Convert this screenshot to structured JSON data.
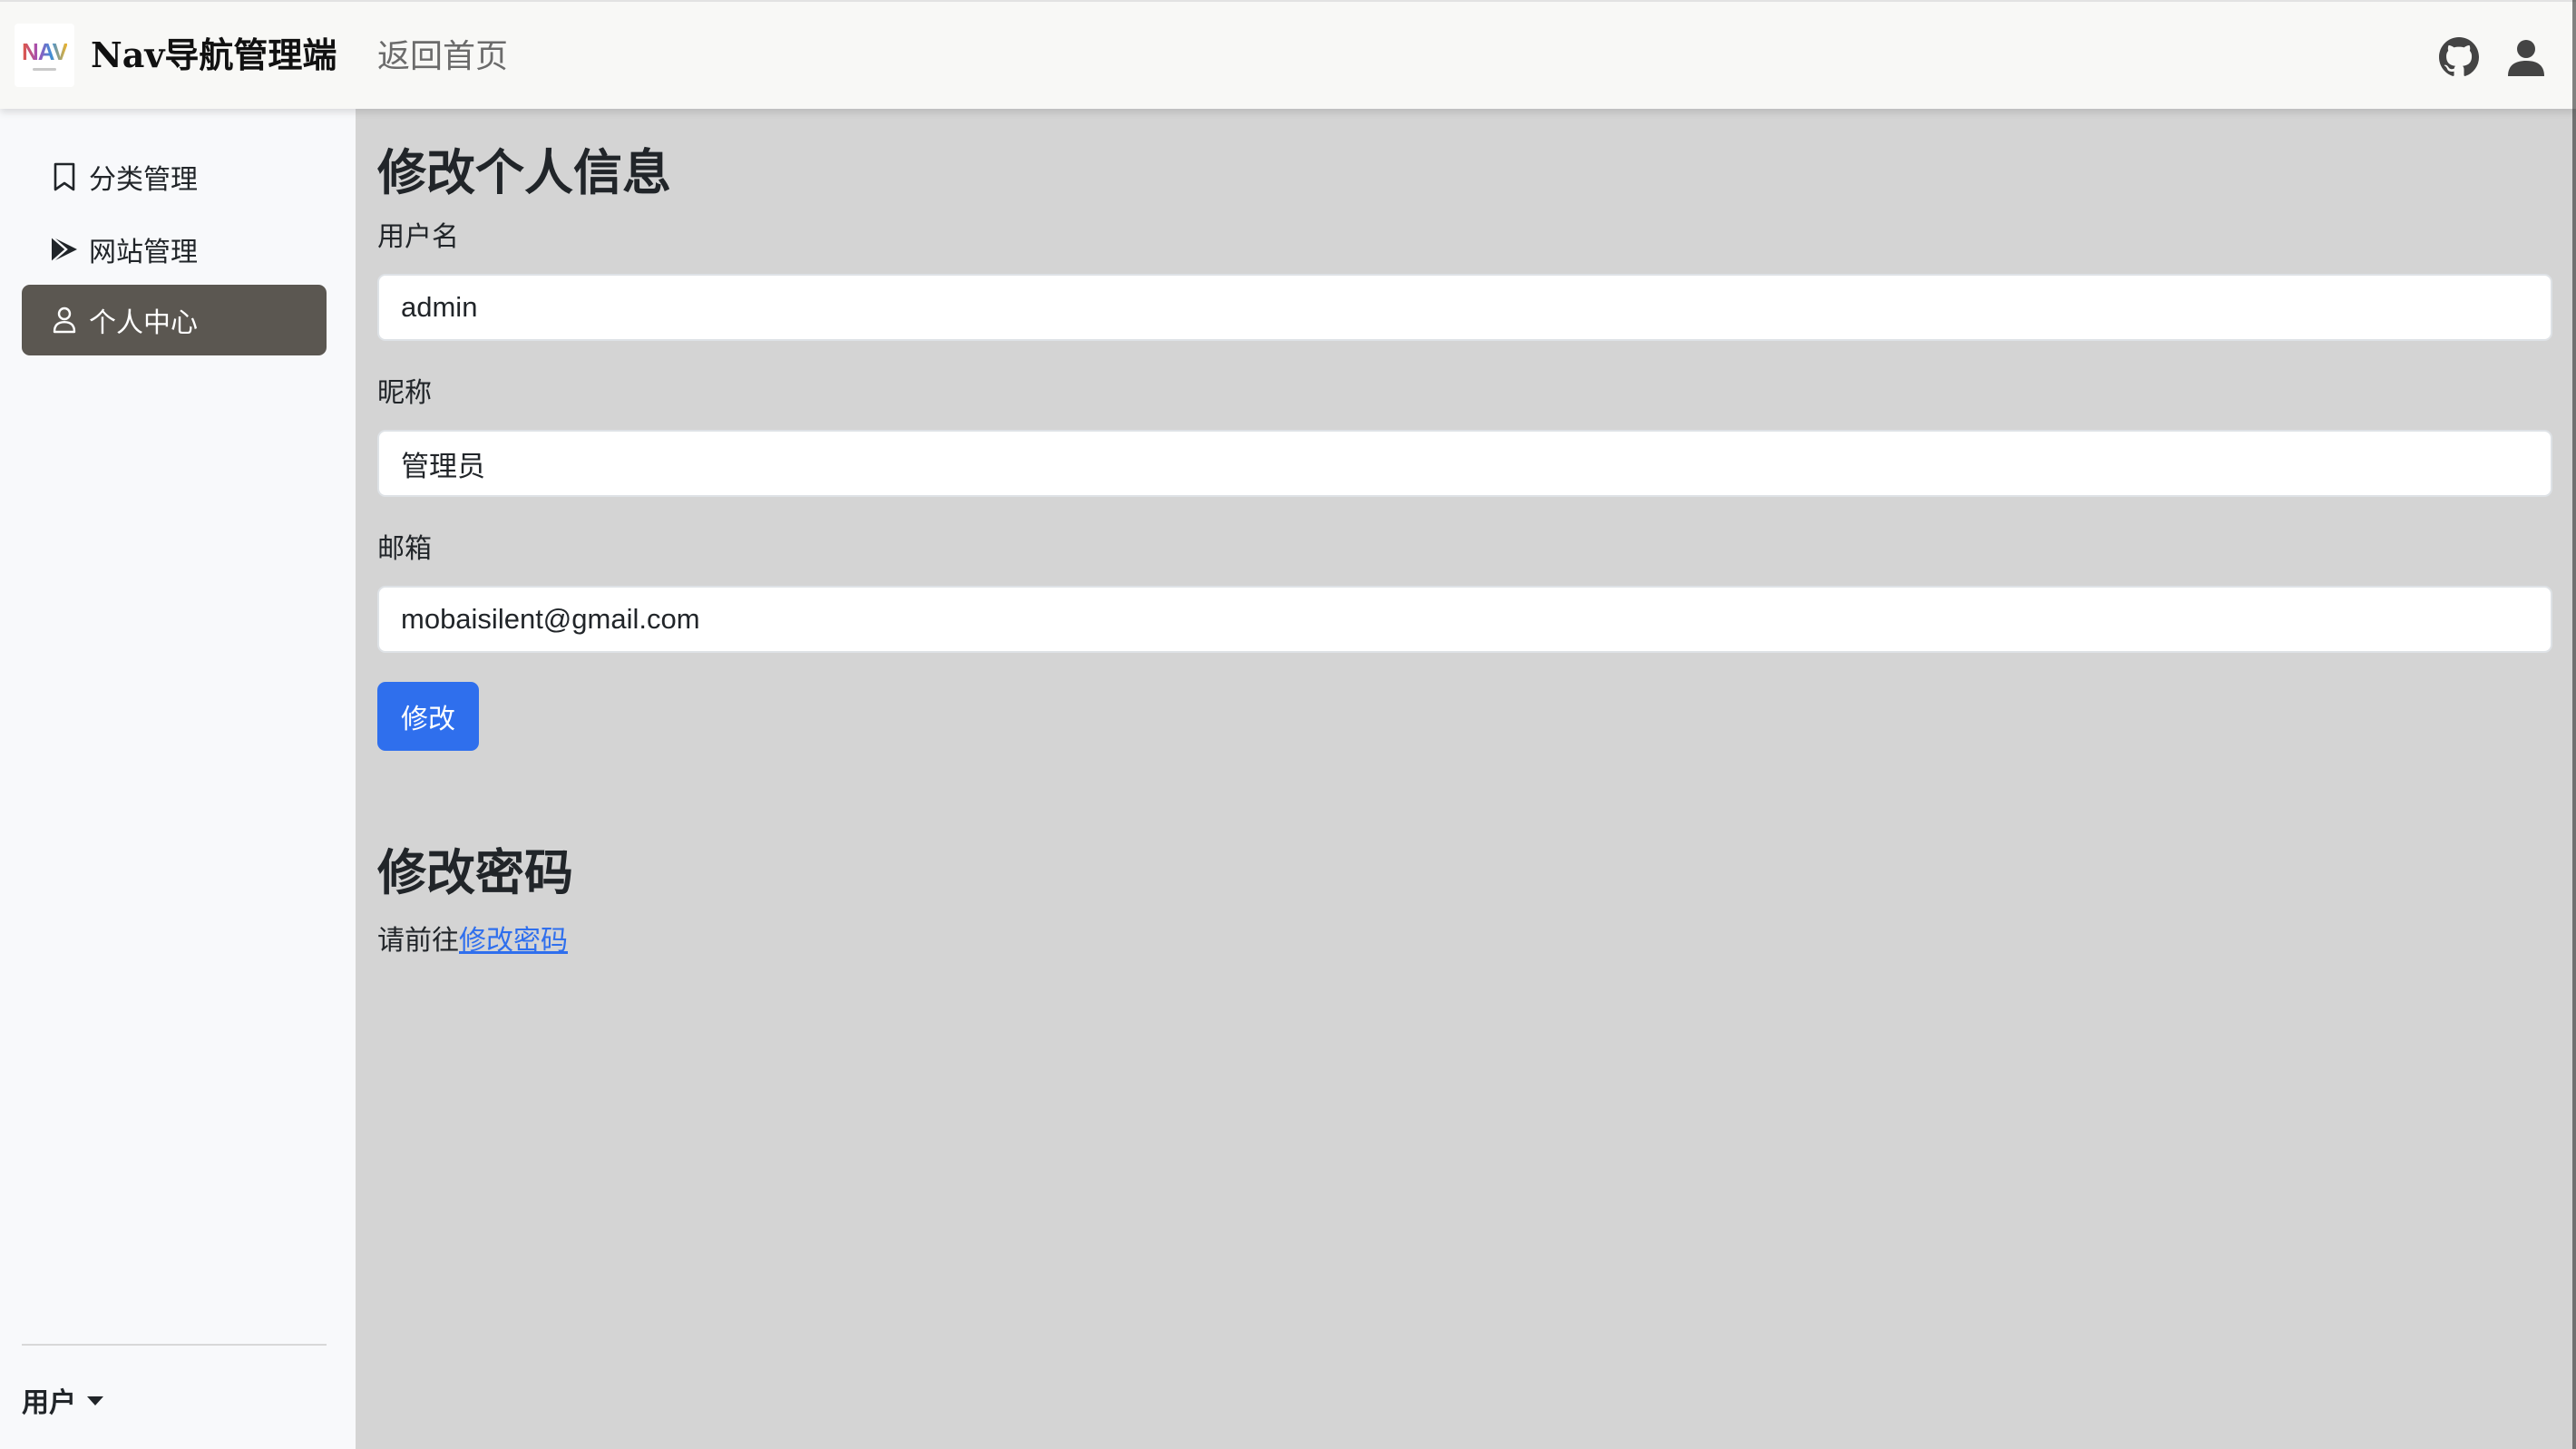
{
  "header": {
    "logo_text": "NAV",
    "brand": "Nav导航管理端",
    "home_link": "返回首页",
    "icons": [
      "github-icon",
      "user-icon"
    ]
  },
  "sidebar": {
    "items": [
      {
        "label": "分类管理",
        "icon": "bookmark-icon",
        "active": false
      },
      {
        "label": "网站管理",
        "icon": "play-icon",
        "active": false
      },
      {
        "label": "个人中心",
        "icon": "person-icon",
        "active": true
      }
    ],
    "user_menu": "用户"
  },
  "profile": {
    "title": "修改个人信息",
    "username_label": "用户名",
    "username_value": "admin",
    "nickname_label": "昵称",
    "nickname_value": "管理员",
    "email_label": "邮箱",
    "email_value": "mobaisilent@gmail.com",
    "submit_label": "修改"
  },
  "password": {
    "title": "修改密码",
    "prompt": "请前往",
    "link_text": "修改密码"
  },
  "colors": {
    "primary": "#2f6fed",
    "active_nav": "#5b5751",
    "content_bg": "#d4d4d4",
    "sidebar_bg": "#f8f9fb"
  }
}
